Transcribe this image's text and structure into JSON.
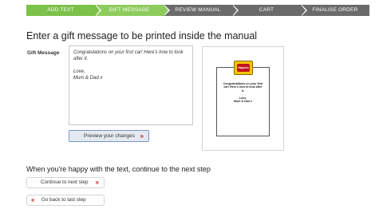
{
  "steps": [
    {
      "label": "ADD TEXT",
      "state": "done"
    },
    {
      "label": "GIFT MESSAGE",
      "state": "active"
    },
    {
      "label": "REVIEW MANUAL",
      "state": "pending"
    },
    {
      "label": "CART",
      "state": "pending"
    },
    {
      "label": "FINALISE ORDER",
      "state": "pending"
    }
  ],
  "page_title": "Enter a gift message to be printed inside the manual",
  "gift": {
    "label": "Gift Message",
    "text": "Congratulations on your first car! Here's how to look after it.\n\nLove,\nMum & Dad x"
  },
  "preview_button": {
    "label": "Preview your changes",
    "chevron": "»"
  },
  "preview": {
    "logo_text": "Haynes",
    "page_text": "Congratulations on your first\ncar! Here's how to look after\nit.\n\nLove,\nMum & Dad x"
  },
  "continue_heading": "When you're happy with the text, continue to the next step",
  "continue_button": {
    "label": "Continue to next step",
    "chevron": "»"
  },
  "back_button": {
    "label": "Go back to last step",
    "chevron": "«"
  },
  "colors": {
    "step_done": "#7cc14a",
    "step_pending": "#6b6b6b",
    "accent_red": "#c0141b",
    "logo_yellow": "#f3c400"
  }
}
